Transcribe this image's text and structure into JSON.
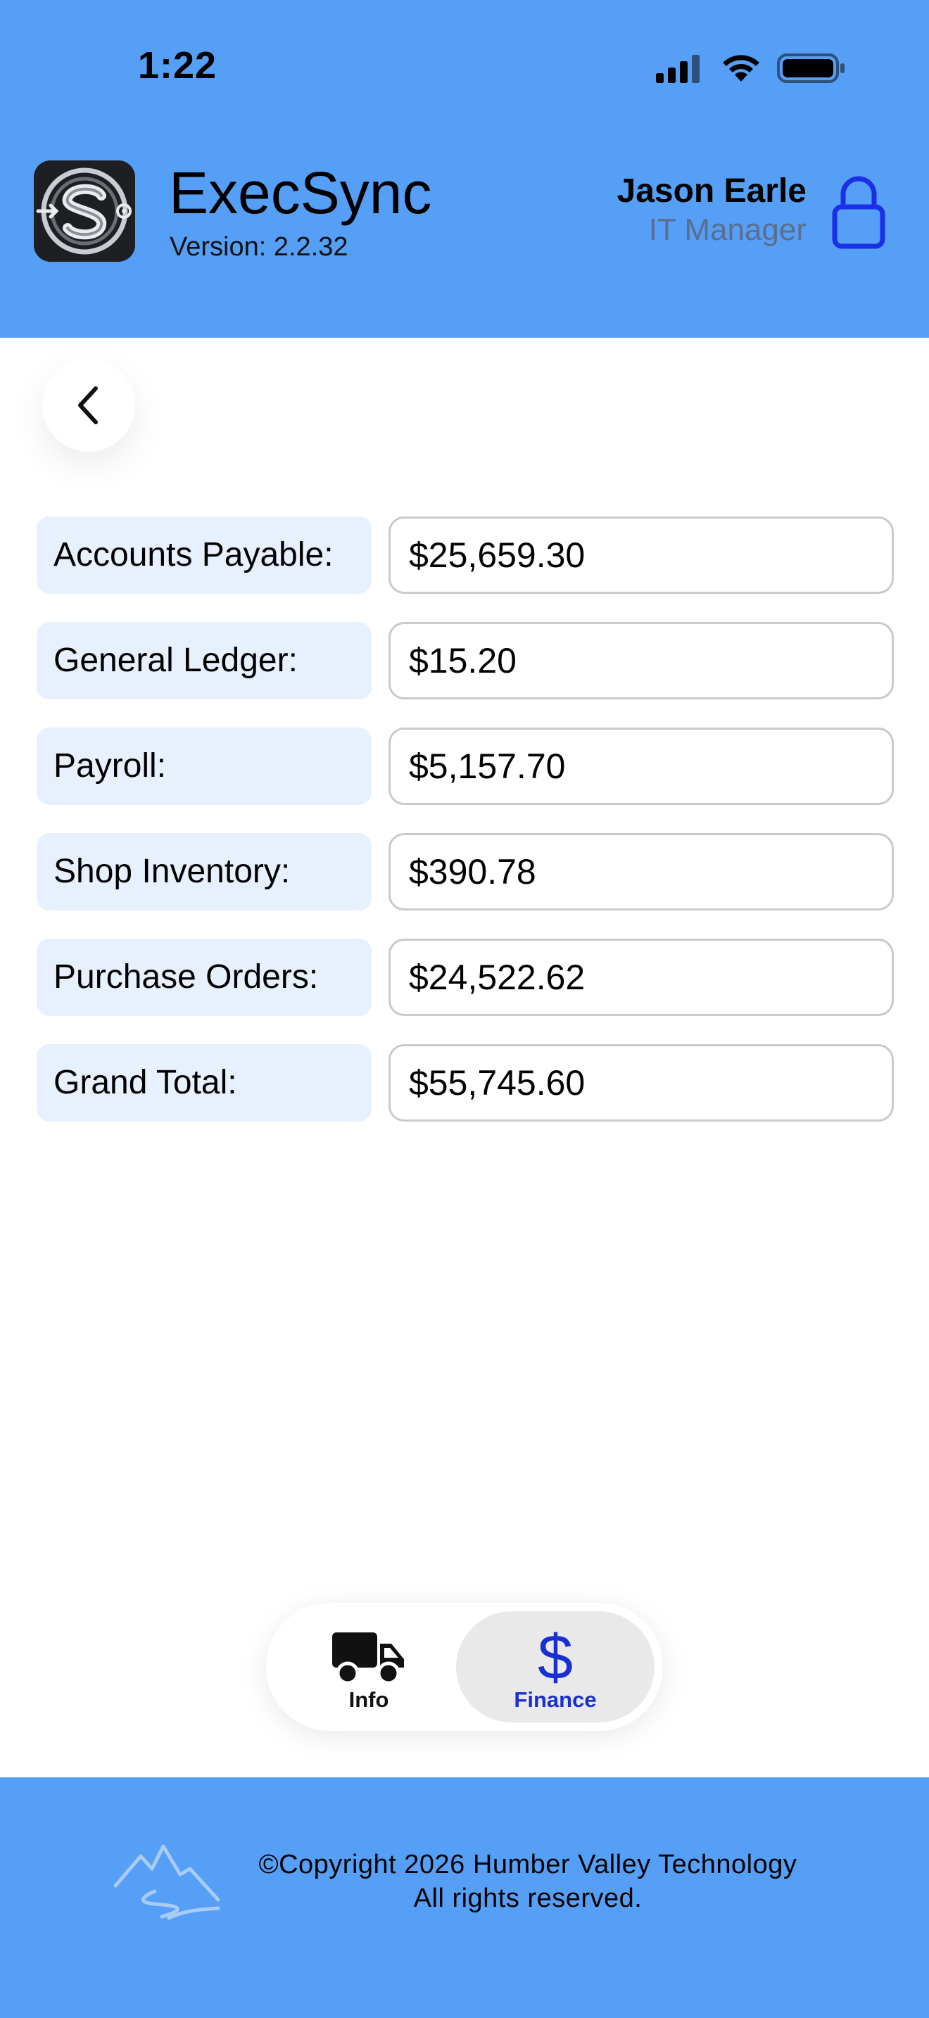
{
  "status_bar": {
    "time": "1:22",
    "icons": [
      "cellular-signal-icon",
      "wifi-icon",
      "battery-icon"
    ]
  },
  "header": {
    "app_name": "ExecSync",
    "version": "Version: 2.2.32",
    "user_name": "Jason Earle",
    "user_role": "IT Manager",
    "lock_icon": "lock-icon",
    "colors": {
      "header_bg": "#569ff6",
      "lock": "#1a2fe6",
      "role_text": "#5a6e91"
    }
  },
  "back_button": {
    "icon": "chevron-left-icon"
  },
  "finance_rows": [
    {
      "label": "Accounts Payable:",
      "value": "$25,659.30"
    },
    {
      "label": "General Ledger:",
      "value": "$15.20"
    },
    {
      "label": "Payroll:",
      "value": "$5,157.70"
    },
    {
      "label": "Shop Inventory:",
      "value": "$390.78"
    },
    {
      "label": "Purchase Orders:",
      "value": "$24,522.62"
    },
    {
      "label": "Grand Total:",
      "value": "$55,745.60"
    }
  ],
  "tabbar": {
    "tabs": [
      {
        "label": "Info",
        "icon": "truck-icon",
        "selected": false
      },
      {
        "label": "Finance",
        "icon": "dollar-icon",
        "selected": true
      }
    ],
    "dollar_glyph": "$",
    "colors": {
      "selected_tint": "#1a2fd1",
      "selected_bg": "#e9e9e9"
    }
  },
  "footer": {
    "copyright": "©Copyright 2026 Humber Valley Technology",
    "rights": "All rights reserved.",
    "logo_icon": "mountain-river-logo-icon",
    "colors": {
      "footer_bg": "#569ff6"
    }
  }
}
